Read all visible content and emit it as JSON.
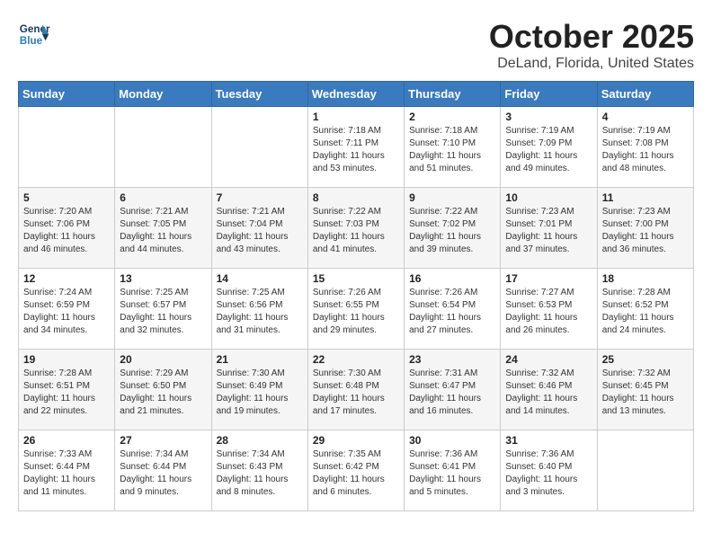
{
  "header": {
    "logo_line1": "General",
    "logo_line2": "Blue",
    "month": "October 2025",
    "location": "DeLand, Florida, United States"
  },
  "weekdays": [
    "Sunday",
    "Monday",
    "Tuesday",
    "Wednesday",
    "Thursday",
    "Friday",
    "Saturday"
  ],
  "weeks": [
    [
      {
        "day": "",
        "info": ""
      },
      {
        "day": "",
        "info": ""
      },
      {
        "day": "",
        "info": ""
      },
      {
        "day": "1",
        "info": "Sunrise: 7:18 AM\nSunset: 7:11 PM\nDaylight: 11 hours and 53 minutes."
      },
      {
        "day": "2",
        "info": "Sunrise: 7:18 AM\nSunset: 7:10 PM\nDaylight: 11 hours and 51 minutes."
      },
      {
        "day": "3",
        "info": "Sunrise: 7:19 AM\nSunset: 7:09 PM\nDaylight: 11 hours and 49 minutes."
      },
      {
        "day": "4",
        "info": "Sunrise: 7:19 AM\nSunset: 7:08 PM\nDaylight: 11 hours and 48 minutes."
      }
    ],
    [
      {
        "day": "5",
        "info": "Sunrise: 7:20 AM\nSunset: 7:06 PM\nDaylight: 11 hours and 46 minutes."
      },
      {
        "day": "6",
        "info": "Sunrise: 7:21 AM\nSunset: 7:05 PM\nDaylight: 11 hours and 44 minutes."
      },
      {
        "day": "7",
        "info": "Sunrise: 7:21 AM\nSunset: 7:04 PM\nDaylight: 11 hours and 43 minutes."
      },
      {
        "day": "8",
        "info": "Sunrise: 7:22 AM\nSunset: 7:03 PM\nDaylight: 11 hours and 41 minutes."
      },
      {
        "day": "9",
        "info": "Sunrise: 7:22 AM\nSunset: 7:02 PM\nDaylight: 11 hours and 39 minutes."
      },
      {
        "day": "10",
        "info": "Sunrise: 7:23 AM\nSunset: 7:01 PM\nDaylight: 11 hours and 37 minutes."
      },
      {
        "day": "11",
        "info": "Sunrise: 7:23 AM\nSunset: 7:00 PM\nDaylight: 11 hours and 36 minutes."
      }
    ],
    [
      {
        "day": "12",
        "info": "Sunrise: 7:24 AM\nSunset: 6:59 PM\nDaylight: 11 hours and 34 minutes."
      },
      {
        "day": "13",
        "info": "Sunrise: 7:25 AM\nSunset: 6:57 PM\nDaylight: 11 hours and 32 minutes."
      },
      {
        "day": "14",
        "info": "Sunrise: 7:25 AM\nSunset: 6:56 PM\nDaylight: 11 hours and 31 minutes."
      },
      {
        "day": "15",
        "info": "Sunrise: 7:26 AM\nSunset: 6:55 PM\nDaylight: 11 hours and 29 minutes."
      },
      {
        "day": "16",
        "info": "Sunrise: 7:26 AM\nSunset: 6:54 PM\nDaylight: 11 hours and 27 minutes."
      },
      {
        "day": "17",
        "info": "Sunrise: 7:27 AM\nSunset: 6:53 PM\nDaylight: 11 hours and 26 minutes."
      },
      {
        "day": "18",
        "info": "Sunrise: 7:28 AM\nSunset: 6:52 PM\nDaylight: 11 hours and 24 minutes."
      }
    ],
    [
      {
        "day": "19",
        "info": "Sunrise: 7:28 AM\nSunset: 6:51 PM\nDaylight: 11 hours and 22 minutes."
      },
      {
        "day": "20",
        "info": "Sunrise: 7:29 AM\nSunset: 6:50 PM\nDaylight: 11 hours and 21 minutes."
      },
      {
        "day": "21",
        "info": "Sunrise: 7:30 AM\nSunset: 6:49 PM\nDaylight: 11 hours and 19 minutes."
      },
      {
        "day": "22",
        "info": "Sunrise: 7:30 AM\nSunset: 6:48 PM\nDaylight: 11 hours and 17 minutes."
      },
      {
        "day": "23",
        "info": "Sunrise: 7:31 AM\nSunset: 6:47 PM\nDaylight: 11 hours and 16 minutes."
      },
      {
        "day": "24",
        "info": "Sunrise: 7:32 AM\nSunset: 6:46 PM\nDaylight: 11 hours and 14 minutes."
      },
      {
        "day": "25",
        "info": "Sunrise: 7:32 AM\nSunset: 6:45 PM\nDaylight: 11 hours and 13 minutes."
      }
    ],
    [
      {
        "day": "26",
        "info": "Sunrise: 7:33 AM\nSunset: 6:44 PM\nDaylight: 11 hours and 11 minutes."
      },
      {
        "day": "27",
        "info": "Sunrise: 7:34 AM\nSunset: 6:44 PM\nDaylight: 11 hours and 9 minutes."
      },
      {
        "day": "28",
        "info": "Sunrise: 7:34 AM\nSunset: 6:43 PM\nDaylight: 11 hours and 8 minutes."
      },
      {
        "day": "29",
        "info": "Sunrise: 7:35 AM\nSunset: 6:42 PM\nDaylight: 11 hours and 6 minutes."
      },
      {
        "day": "30",
        "info": "Sunrise: 7:36 AM\nSunset: 6:41 PM\nDaylight: 11 hours and 5 minutes."
      },
      {
        "day": "31",
        "info": "Sunrise: 7:36 AM\nSunset: 6:40 PM\nDaylight: 11 hours and 3 minutes."
      },
      {
        "day": "",
        "info": ""
      }
    ]
  ]
}
